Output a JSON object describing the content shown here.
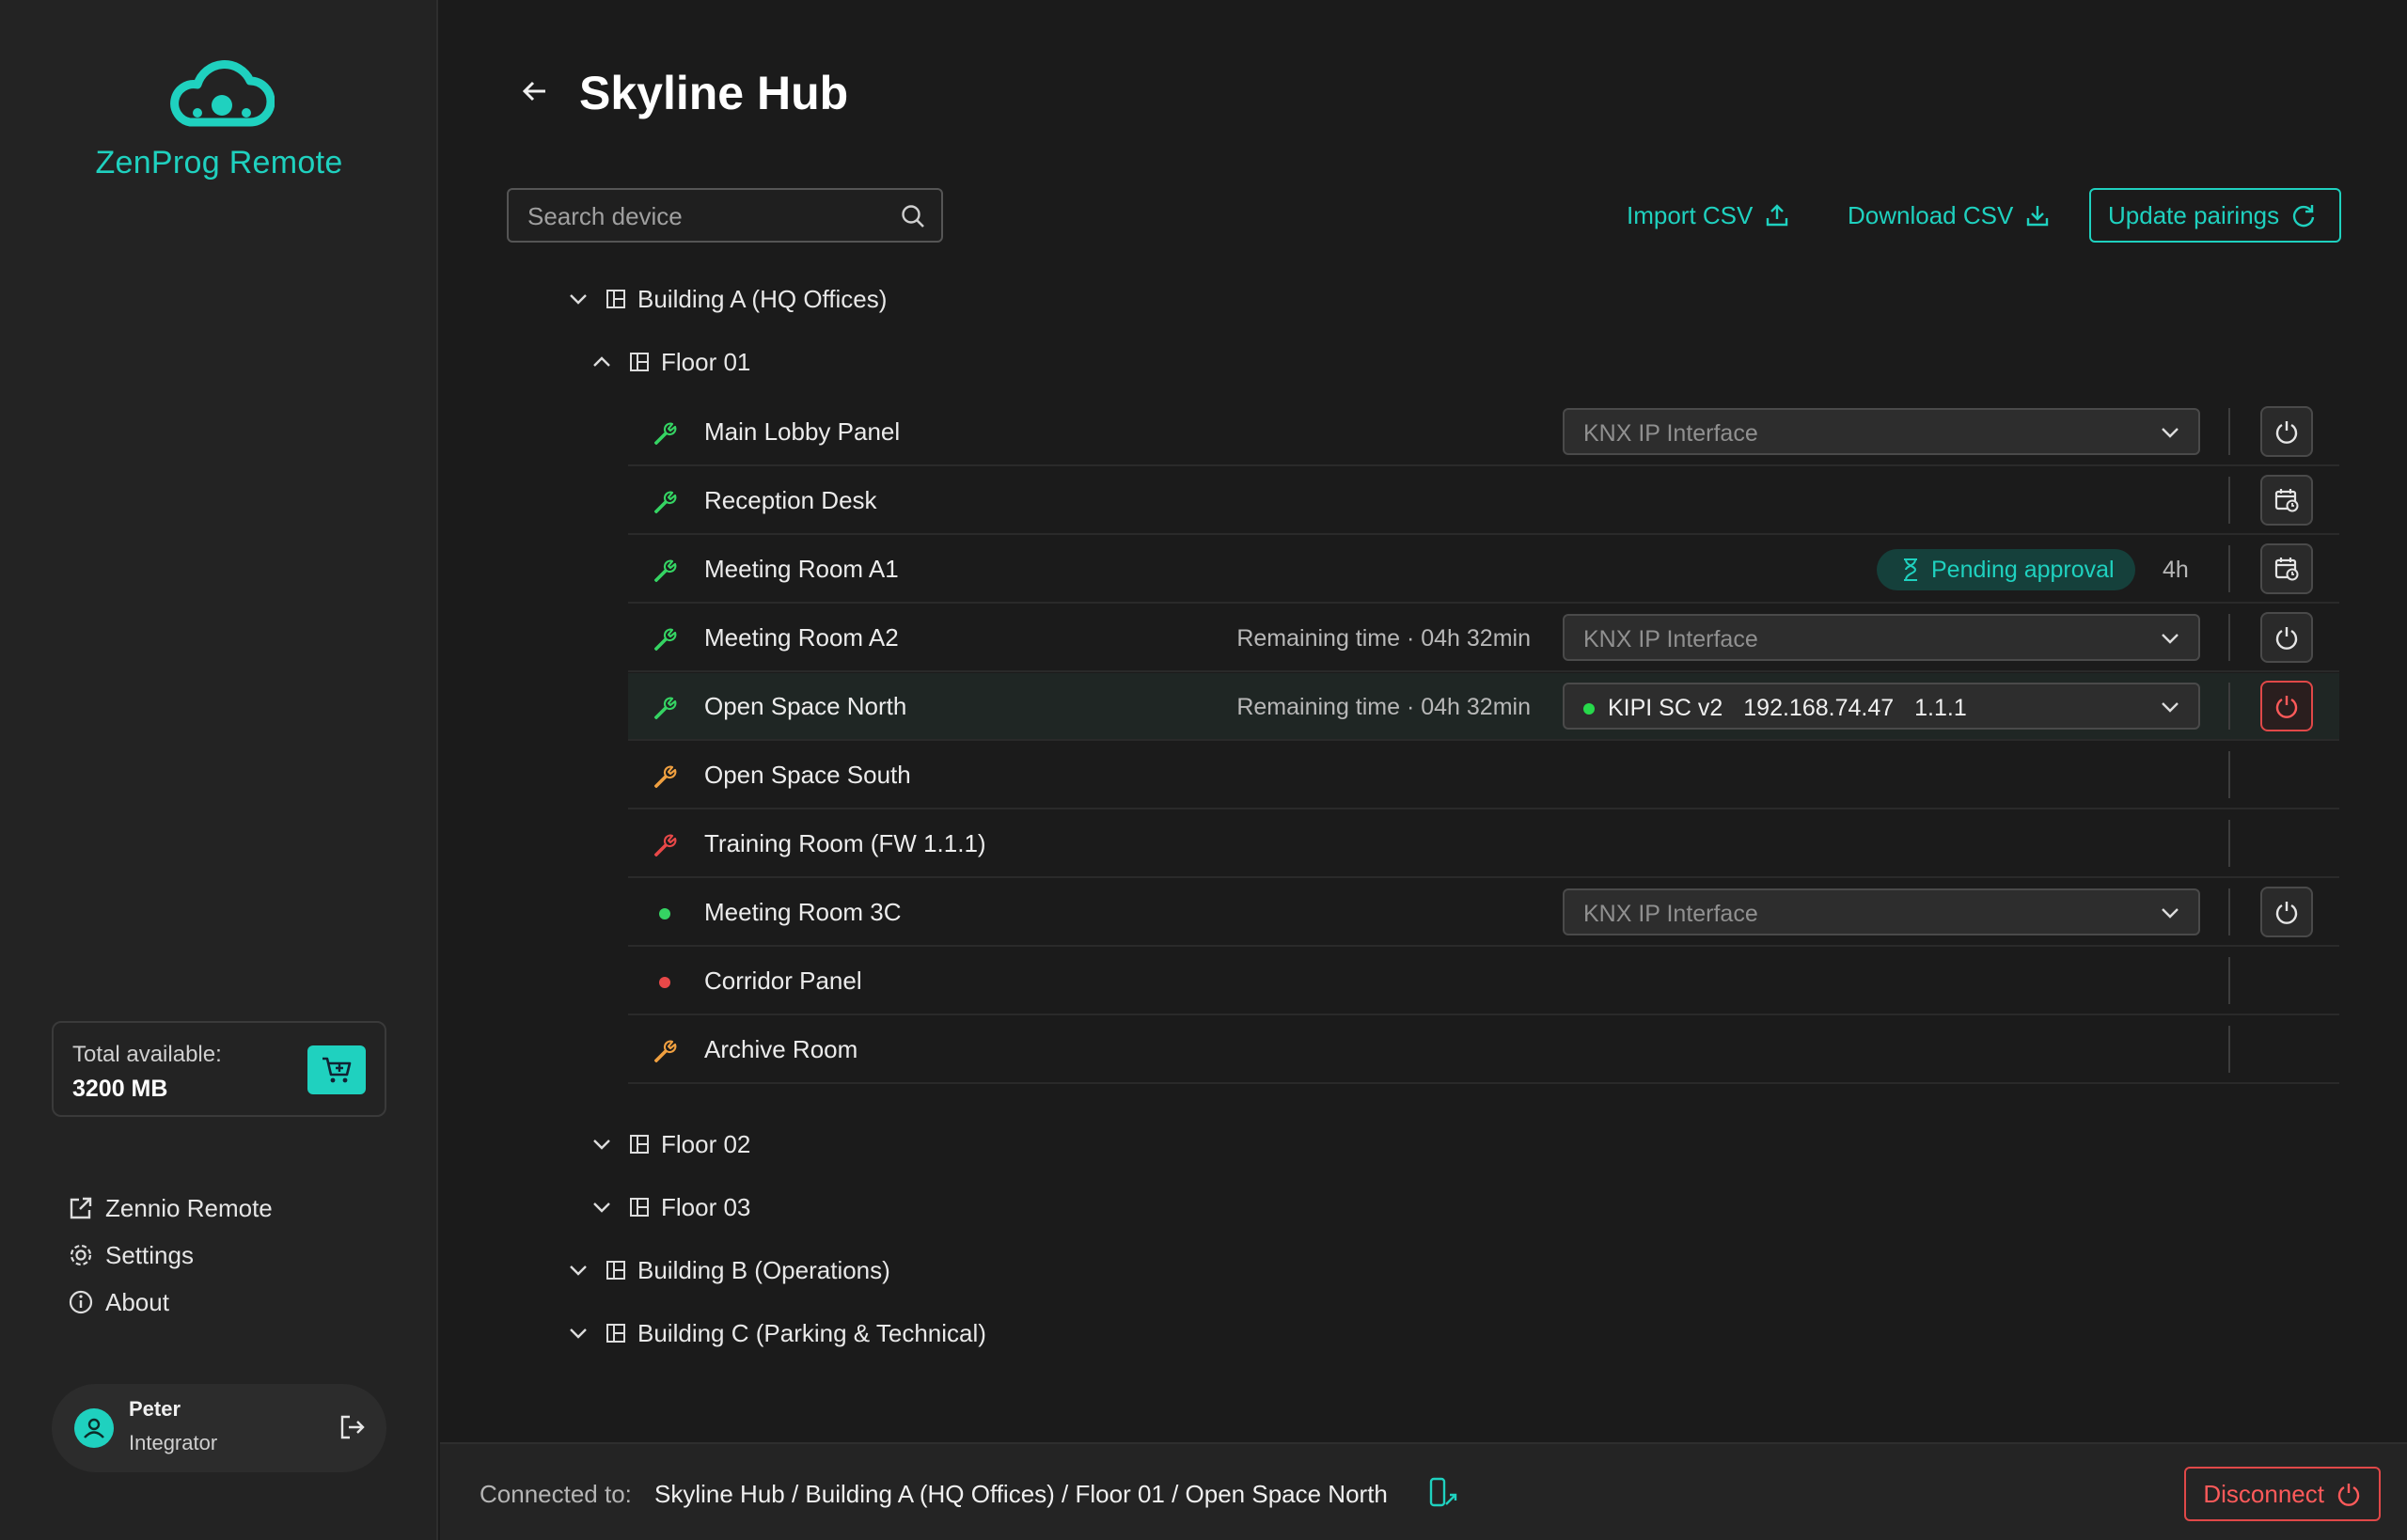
{
  "app": {
    "brand_name": "ZenProg Remote",
    "accent_color": "#1fd1bf"
  },
  "sidebar": {
    "storage": {
      "label": "Total available:",
      "value": "3200 MB"
    },
    "links": [
      {
        "label": "Zennio Remote",
        "icon": "external-link-icon"
      },
      {
        "label": "Settings",
        "icon": "gear-icon"
      },
      {
        "label": "About",
        "icon": "info-icon"
      }
    ],
    "user": {
      "name": "Peter",
      "role": "Integrator"
    }
  },
  "header": {
    "title": "Skyline Hub"
  },
  "toolbar": {
    "search_placeholder": "Search device",
    "import_label": "Import CSV",
    "download_label": "Download CSV",
    "update_label": "Update pairings"
  },
  "tree": {
    "building_a": "Building A (HQ Offices)",
    "floor_01": "Floor 01",
    "floor_02": "Floor 02",
    "floor_03": "Floor 03",
    "building_b": "Building B (Operations)",
    "building_c": "Building C (Parking & Technical)"
  },
  "devices": [
    {
      "name": "Main Lobby Panel",
      "status": "green-wrench",
      "interface": "KNX IP Interface",
      "action": "power"
    },
    {
      "name": "Reception Desk",
      "status": "green-wrench",
      "action": "schedule"
    },
    {
      "name": "Meeting Room A1",
      "status": "green-wrench",
      "badge": "Pending approval",
      "hours": "4h",
      "action": "schedule"
    },
    {
      "name": "Meeting Room A2",
      "status": "green-wrench",
      "remaining": "Remaining time · 04h 32min",
      "interface": "KNX IP Interface",
      "action": "power"
    },
    {
      "name": "Open Space North",
      "status": "green-wrench",
      "remaining": "Remaining time · 04h 32min",
      "selected_interface": {
        "name": "KIPI SC v2",
        "ip": "192.168.74.47",
        "address": "1.1.1"
      },
      "action": "power-active"
    },
    {
      "name": "Open Space South",
      "status": "orange-wrench"
    },
    {
      "name": "Training Room (FW 1.1.1)",
      "status": "red-wrench"
    },
    {
      "name": "Meeting Room 3C",
      "status": "green-dot",
      "interface": "KNX IP Interface",
      "action": "power"
    },
    {
      "name": "Corridor Panel",
      "status": "red-dot"
    },
    {
      "name": "Archive Room",
      "status": "orange-wrench"
    }
  ],
  "status_colors": {
    "green": "#35d463",
    "orange": "#f0a040",
    "red": "#e84848"
  },
  "footer": {
    "connected_label": "Connected to:",
    "connected_path": "Skyline Hub / Building A (HQ Offices) / Floor 01 / Open Space North",
    "disconnect_label": "Disconnect"
  }
}
